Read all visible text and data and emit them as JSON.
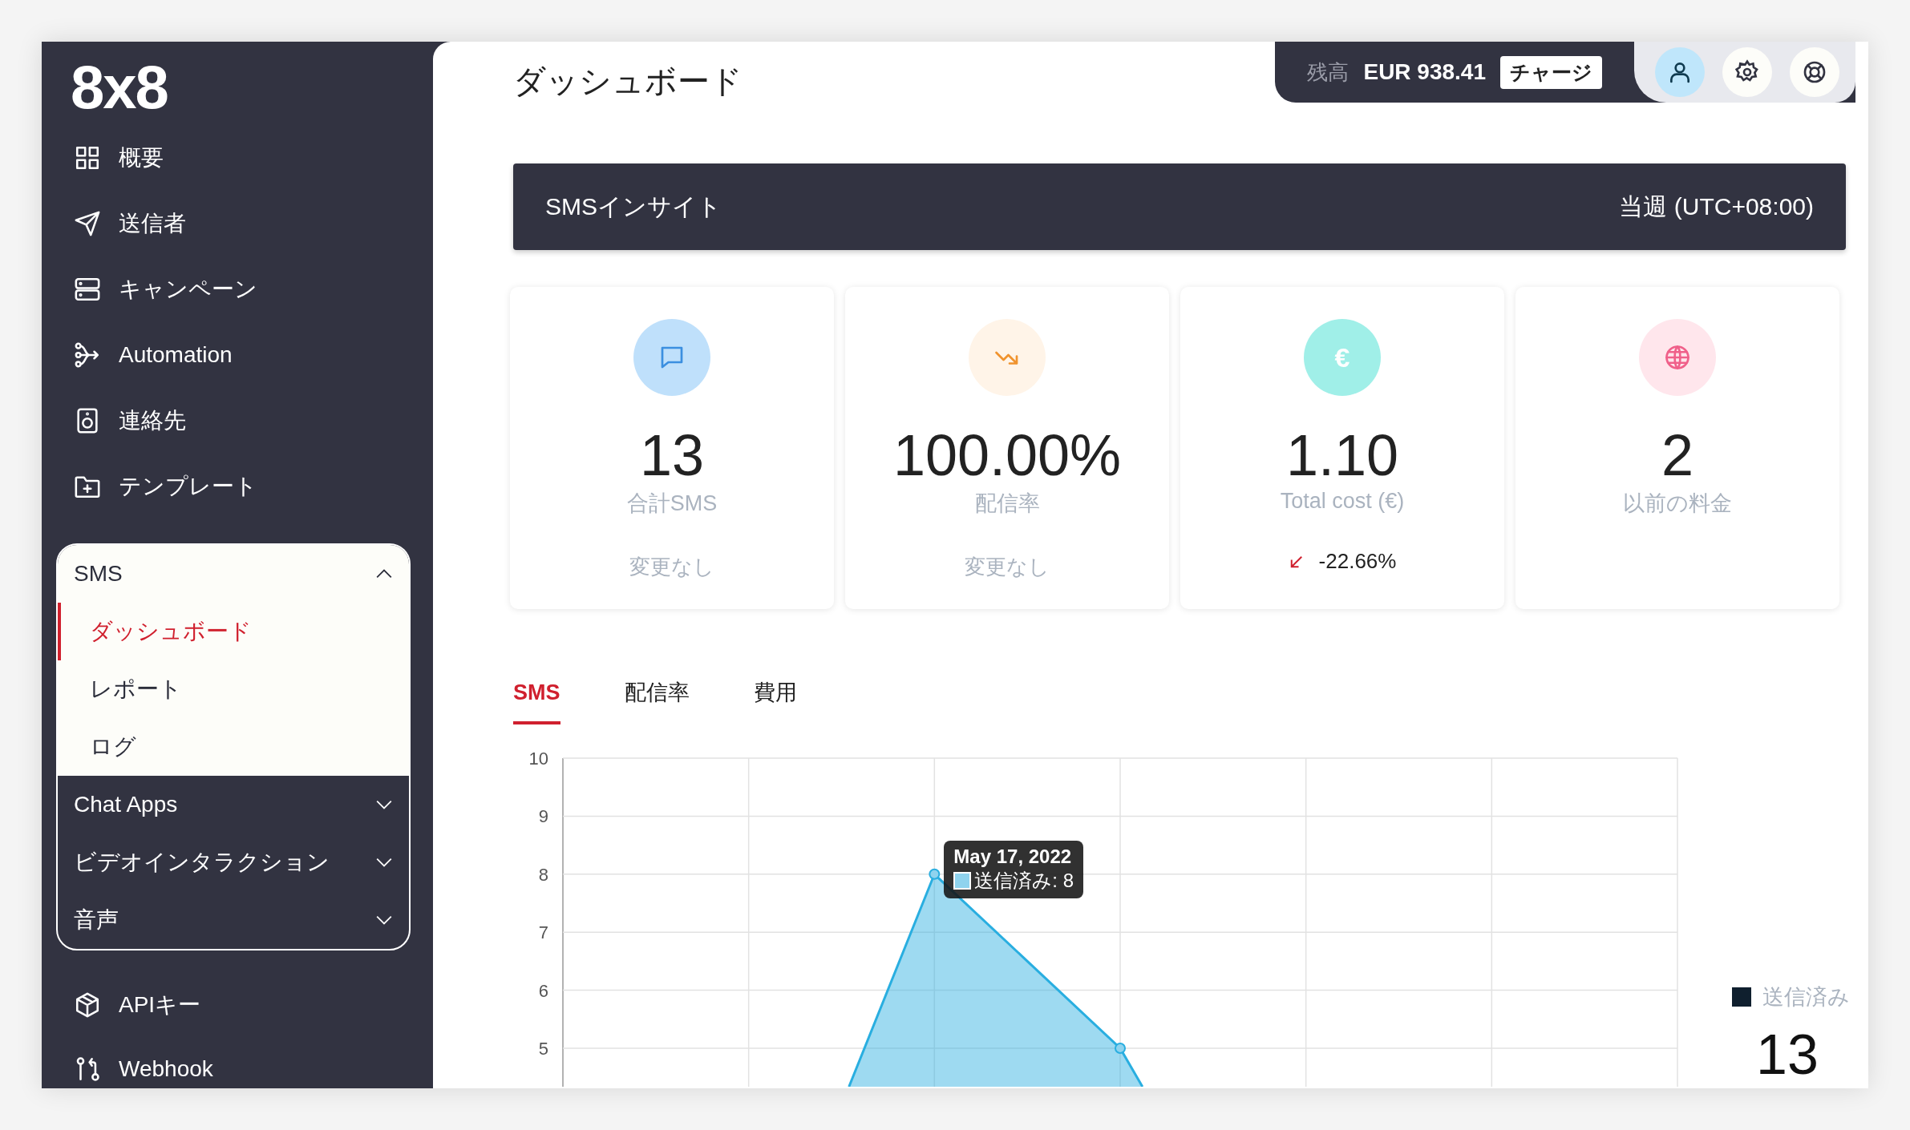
{
  "logo": "8x8",
  "nav": [
    {
      "label": "概要"
    },
    {
      "label": "送信者"
    },
    {
      "label": "キャンペーン"
    },
    {
      "label": "Automation"
    },
    {
      "label": "連絡先"
    },
    {
      "label": "テンプレート"
    }
  ],
  "groups": [
    {
      "label": "SMS",
      "expanded": true,
      "children": [
        {
          "label": "ダッシュボード",
          "selected": true
        },
        {
          "label": "レポート",
          "selected": false
        },
        {
          "label": "ログ",
          "selected": false
        }
      ]
    },
    {
      "label": "Chat Apps",
      "expanded": false
    },
    {
      "label": "ビデオインタラクション",
      "expanded": false
    },
    {
      "label": "音声",
      "expanded": false
    }
  ],
  "nav_bottom": [
    {
      "label": "APIキー"
    },
    {
      "label": "Webhook"
    }
  ],
  "page_title": "ダッシュボード",
  "balance": {
    "label": "残高",
    "amount": "EUR 938.41",
    "button": "チャージ"
  },
  "header_buttons": [
    {
      "selected": true
    },
    {
      "selected": false
    },
    {
      "selected": false
    }
  ],
  "insight_bar": {
    "title": "SMSインサイト",
    "period": "当週 (UTC+08:00)"
  },
  "stats": [
    {
      "value": "13",
      "label": "合計SMS",
      "change": "変更なし",
      "kind": "flat"
    },
    {
      "value": "100.00%",
      "label": "配信率",
      "change": "変更なし",
      "kind": "flat"
    },
    {
      "glyph": "€",
      "value": "1.10",
      "label": "Total cost (€)",
      "change": "-22.66%",
      "kind": "down"
    },
    {
      "value": "2",
      "label": "以前の料金"
    }
  ],
  "chart_tabs": [
    {
      "label": "SMS",
      "selected": true
    },
    {
      "label": "配信率",
      "selected": false
    },
    {
      "label": "費用",
      "selected": false
    }
  ],
  "chart": {
    "y_labels": [
      "10",
      "9",
      "8",
      "7",
      "6",
      "5"
    ],
    "tooltip": {
      "title": "May 17, 2022",
      "label": "送信済み: 8"
    },
    "legend": {
      "label": "送信済み",
      "total": "13"
    }
  }
}
